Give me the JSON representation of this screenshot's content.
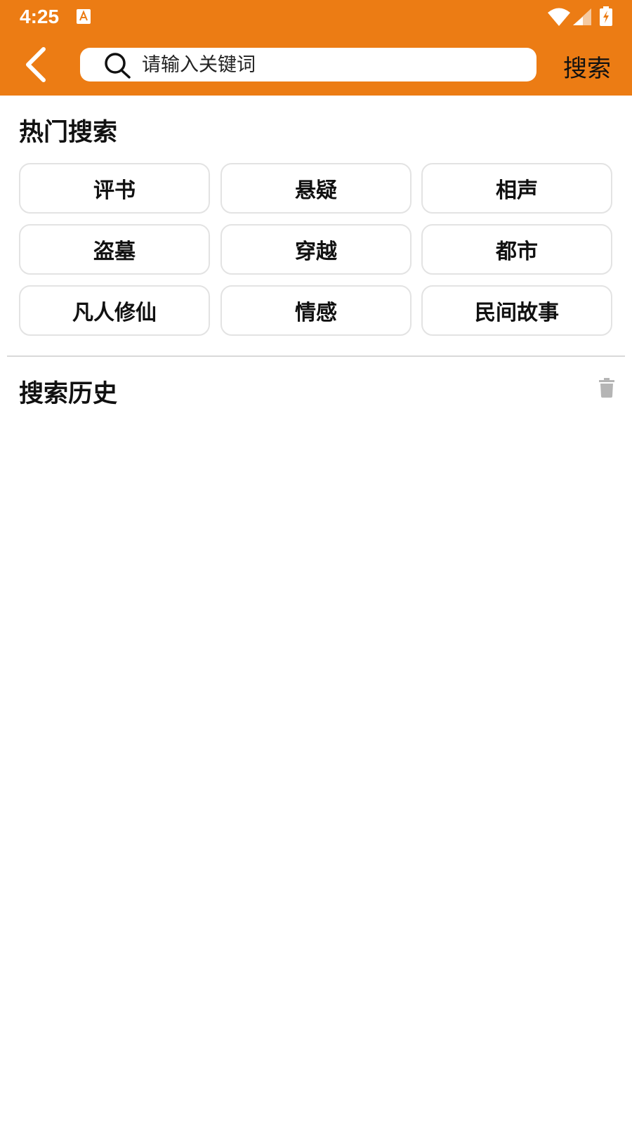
{
  "status_bar": {
    "time": "4:25",
    "notification_icon": "a-store-icon",
    "wifi_icon": "wifi-icon",
    "signal_icon": "signal-icon",
    "battery_icon": "battery-charging-icon"
  },
  "header": {
    "back_icon": "chevron-left-icon",
    "search": {
      "icon": "search-icon",
      "placeholder": "请输入关键词",
      "value": ""
    },
    "submit_label": "搜索"
  },
  "hot_search": {
    "title": "热门搜索",
    "tags": [
      "评书",
      "悬疑",
      "相声",
      "盗墓",
      "穿越",
      "都市",
      "凡人修仙",
      "情感",
      "民间故事"
    ]
  },
  "history": {
    "title": "搜索历史",
    "delete_icon": "trash-icon",
    "items": []
  },
  "colors": {
    "accent": "#ec7c14",
    "tag_border": "#e3e3e3",
    "divider": "#d9d9d9",
    "text": "#111111",
    "icon_gray": "#b5b5b5"
  }
}
